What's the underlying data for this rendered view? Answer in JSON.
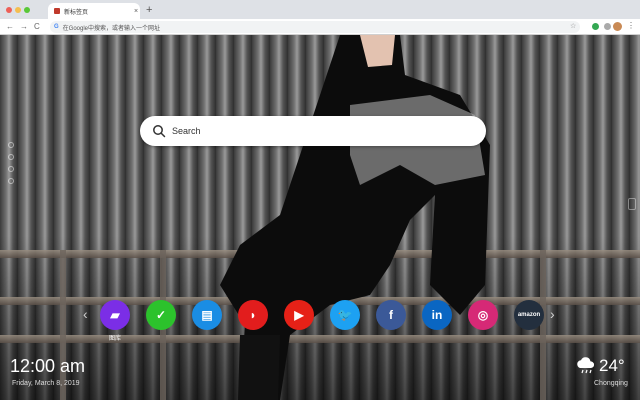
{
  "browser": {
    "tab_title": "新标签页",
    "tab_close": "×",
    "new_tab": "+",
    "address_placeholder": "在Google中搜索，或者输入一个网址",
    "google_letter": "G",
    "back": "←",
    "forward": "→",
    "reload": "C",
    "bookmark_star": "☆",
    "menu": "⋮",
    "traffic_colors": [
      "#ee5f57",
      "#f5be4f",
      "#59c837"
    ]
  },
  "search": {
    "placeholder": "Search"
  },
  "apps": [
    {
      "name": "gallery",
      "label": "图库",
      "color": "#7b2ee6",
      "glyph": "▰"
    },
    {
      "name": "check",
      "label": "",
      "color": "#2cc22c",
      "glyph": "✓"
    },
    {
      "name": "notes",
      "label": "",
      "color": "#1a8de4",
      "glyph": "▤"
    },
    {
      "name": "game",
      "label": "",
      "color": "#e21d1d",
      "glyph": "◗"
    },
    {
      "name": "youtube",
      "label": "",
      "color": "#e62117",
      "glyph": "▶"
    },
    {
      "name": "twitter",
      "label": "",
      "color": "#1da1f2",
      "glyph": "🐦"
    },
    {
      "name": "facebook",
      "label": "",
      "color": "#3b5998",
      "glyph": "f"
    },
    {
      "name": "linkedin",
      "label": "",
      "color": "#0a66c2",
      "glyph": "in"
    },
    {
      "name": "instagram",
      "label": "",
      "color": "#d62976",
      "glyph": "◎"
    },
    {
      "name": "amazon",
      "label": "",
      "color": "#232f3e",
      "glyph": "amazon"
    }
  ],
  "nav": {
    "prev": "‹",
    "next": "›"
  },
  "clock": {
    "time": "12:00 am",
    "date": "Friday, March 8, 2019"
  },
  "weather": {
    "temp": "24°",
    "city": "Chongqing",
    "icon": "cloud-rain-icon"
  }
}
